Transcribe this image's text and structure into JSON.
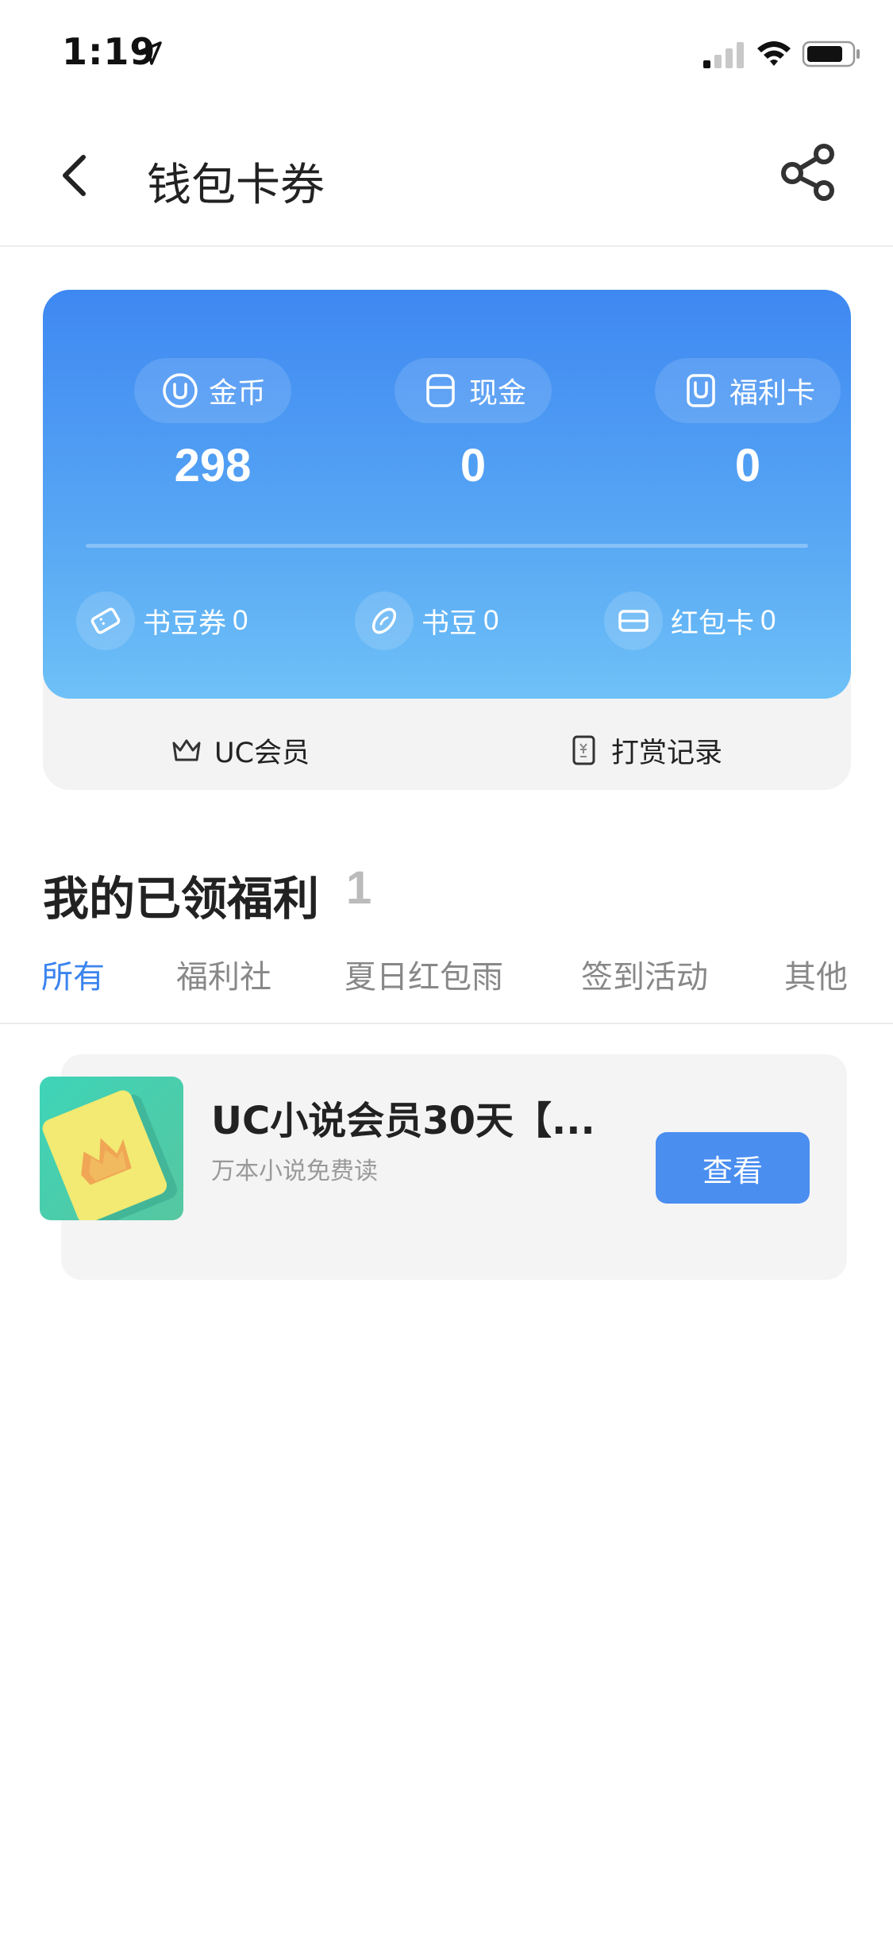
{
  "status_bar": {
    "time": "1:19"
  },
  "nav": {
    "title": "钱包卡券"
  },
  "wallet": {
    "balances": [
      {
        "label": "金币",
        "value": "298",
        "icon": "coin-icon"
      },
      {
        "label": "现金",
        "value": "0",
        "icon": "cash-icon"
      },
      {
        "label": "福利卡",
        "value": "0",
        "icon": "welfare-card-icon"
      }
    ],
    "sub_items": [
      {
        "label": "书豆券",
        "count": "0",
        "icon": "ticket-icon"
      },
      {
        "label": "书豆",
        "count": "0",
        "icon": "bean-icon"
      },
      {
        "label": "红包卡",
        "count": "0",
        "icon": "red-packet-card-icon"
      }
    ],
    "links": [
      {
        "label": "UC会员",
        "icon": "crown-icon"
      },
      {
        "label": "打赏记录",
        "icon": "reward-record-icon"
      }
    ]
  },
  "benefits": {
    "title": "我的已领福利",
    "count": "1",
    "tabs": [
      "所有",
      "福利社",
      "夏日红包雨",
      "签到活动",
      "其他"
    ],
    "active_tab": "所有",
    "items": [
      {
        "name": "UC小说会员30天【...",
        "desc": "万本小说免费读",
        "action": "查看"
      }
    ]
  },
  "colors": {
    "accent": "#3b84ee",
    "card_gradient_top": "#3e88f2",
    "card_gradient_bottom": "#6ec1f7"
  }
}
